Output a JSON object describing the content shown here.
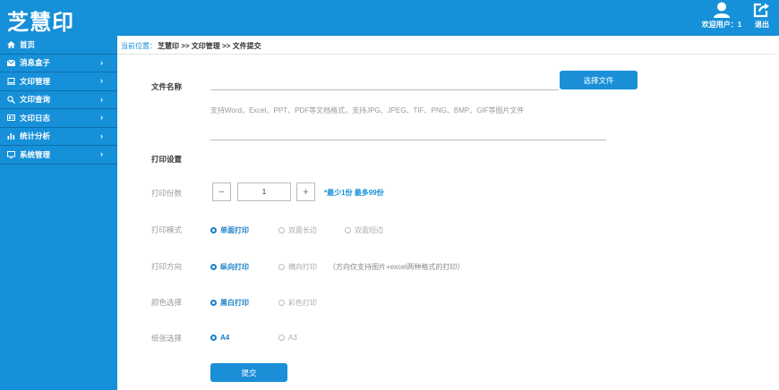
{
  "header": {
    "logo": "芝慧印",
    "welcome_text": "欢迎用户：1",
    "logout_label": "退出",
    "user_icon": "user-icon",
    "logout_icon": "logout-icon"
  },
  "sidebar": {
    "items": [
      {
        "label": "首页",
        "icon": "home-icon",
        "has_arrow": false
      },
      {
        "label": "消息盒子",
        "icon": "mail-icon",
        "has_arrow": true
      },
      {
        "label": "文印管理",
        "icon": "monitor-icon",
        "has_arrow": true
      },
      {
        "label": "文印查询",
        "icon": "search-icon",
        "has_arrow": true
      },
      {
        "label": "文印日志",
        "icon": "log-icon",
        "has_arrow": true
      },
      {
        "label": "统计分析",
        "icon": "chart-icon",
        "has_arrow": true
      },
      {
        "label": "系统管理",
        "icon": "screen-icon",
        "has_arrow": true
      }
    ],
    "arrow_glyph": "›"
  },
  "breadcrumb": {
    "label": "当前位置：",
    "path": "芝慧印 >> 文印管理 >> 文件提交"
  },
  "form": {
    "file_name_label": "文件名称",
    "choose_file_label": "选择文件",
    "file_hint": "支持Word、Excel、PPT、PDF等文档格式，支持JPG、JPEG、TIF、PNG、BMP、GIF等图片文件",
    "print_settings_title": "打印设置",
    "copies": {
      "label": "打印份数",
      "minus": "−",
      "plus": "+",
      "value": "1",
      "note": "*最少1份 最多99份"
    },
    "print_mode": {
      "label": "打印模式",
      "options": [
        "单面打印",
        "双面长边",
        "双面短边"
      ],
      "selected": 0
    },
    "orientation": {
      "label": "打印方向",
      "options": [
        "纵向打印",
        "横向打印"
      ],
      "selected": 0,
      "note": "（方向仅支持图片+excel两种格式的打印）"
    },
    "color": {
      "label": "颜色选择",
      "options": [
        "黑白打印",
        "彩色打印"
      ],
      "selected": 0
    },
    "paper": {
      "label": "纸张选择",
      "options": [
        "A4",
        "A3"
      ],
      "selected": 0
    },
    "submit_label": "提交"
  },
  "colors": {
    "brand_blue": "#1690d8",
    "accent_blue": "#1a7fc8"
  }
}
